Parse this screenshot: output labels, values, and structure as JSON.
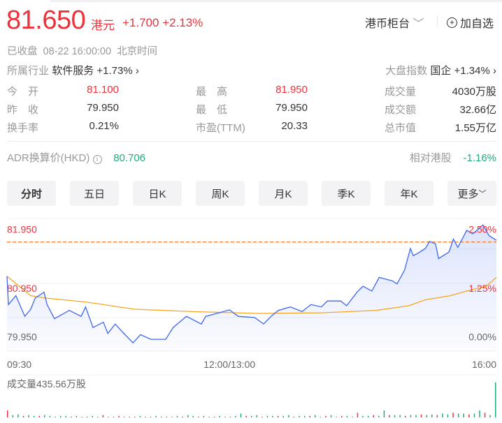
{
  "quote": {
    "price": "81.650",
    "currency": "港元",
    "change": "+1.700",
    "change_pct": "+2.13%"
  },
  "header": {
    "counter": "港币柜台",
    "add_watchlist": "加自选"
  },
  "status": {
    "state": "已收盘",
    "time": "08-22 16:00:00",
    "timezone": "北京时间"
  },
  "industry": {
    "label": "所属行业",
    "name": "软件服务",
    "change": "+1.73%"
  },
  "index": {
    "label": "大盘指数",
    "name": "国企",
    "change": "+1.34%"
  },
  "stats": [
    {
      "label": "今　开",
      "value": "81.100",
      "color": "red"
    },
    {
      "label": "最　高",
      "value": "81.950",
      "color": "red"
    },
    {
      "label": "成交量",
      "value": "4030万股",
      "color": ""
    },
    {
      "label": "昨　收",
      "value": "79.950",
      "color": ""
    },
    {
      "label": "最　低",
      "value": "79.950",
      "color": ""
    },
    {
      "label": "成交额",
      "value": "32.66亿",
      "color": ""
    },
    {
      "label": "换手率",
      "value": "0.21%",
      "color": ""
    },
    {
      "label": "市盈(TTM)",
      "value": "20.33",
      "color": ""
    },
    {
      "label": "总市值",
      "value": "1.55万亿",
      "color": ""
    }
  ],
  "adr": {
    "label": "ADR换算价(HKD)",
    "value": "80.706",
    "relative_label": "相对港股",
    "relative_value": "-1.16%"
  },
  "tabs": [
    "分时",
    "五日",
    "日K",
    "周K",
    "月K",
    "季K",
    "年K",
    "更多"
  ],
  "active_tab": "分时",
  "colors": {
    "up": "#f0303a",
    "down": "#1fad7e",
    "price_line": "#3d66f2",
    "avg_line": "#f5a623",
    "dash": "#f5873a"
  },
  "chart_data": {
    "type": "line",
    "title": "分时",
    "ylim": [
      79.8,
      82.05
    ],
    "xlim": [
      0,
      330
    ],
    "prev_close": 79.95,
    "last_price": 81.65,
    "y_labels_left": [
      "81.950",
      "80.950",
      "79.950"
    ],
    "y_label_values": [
      81.95,
      80.95,
      79.95
    ],
    "y_labels_right": [
      "2.50%",
      "1.25%",
      "0.00%"
    ],
    "x_labels": [
      "09:30",
      "12:00/13:00",
      "16:00"
    ],
    "x_label_values": [
      0,
      150,
      330
    ],
    "series": [
      {
        "name": "price",
        "points": [
          [
            0,
            81.07
          ],
          [
            1,
            80.59
          ],
          [
            6,
            80.74
          ],
          [
            12,
            80.39
          ],
          [
            16,
            80.51
          ],
          [
            19,
            80.7
          ],
          [
            25,
            80.8
          ],
          [
            27,
            80.59
          ],
          [
            32,
            80.35
          ],
          [
            42,
            80.49
          ],
          [
            50,
            80.39
          ],
          [
            53,
            80.55
          ],
          [
            58,
            80.2
          ],
          [
            65,
            80.29
          ],
          [
            68,
            80.1
          ],
          [
            73,
            80.26
          ],
          [
            78,
            80.12
          ],
          [
            85,
            79.94
          ],
          [
            90,
            80.08
          ],
          [
            97,
            80.0
          ],
          [
            107,
            80.0
          ],
          [
            112,
            80.2
          ],
          [
            121,
            80.39
          ],
          [
            131,
            80.26
          ],
          [
            134,
            80.39
          ],
          [
            143,
            80.45
          ],
          [
            150,
            80.5
          ],
          [
            156,
            80.39
          ],
          [
            167,
            80.37
          ],
          [
            173,
            80.26
          ],
          [
            178,
            80.39
          ],
          [
            183,
            80.49
          ],
          [
            191,
            80.55
          ],
          [
            199,
            80.47
          ],
          [
            205,
            80.59
          ],
          [
            212,
            80.55
          ],
          [
            216,
            80.65
          ],
          [
            225,
            80.65
          ],
          [
            229,
            80.57
          ],
          [
            236,
            80.8
          ],
          [
            240,
            80.9
          ],
          [
            246,
            80.82
          ],
          [
            251,
            81.05
          ],
          [
            260,
            80.99
          ],
          [
            263,
            80.94
          ],
          [
            268,
            81.17
          ],
          [
            272,
            81.54
          ],
          [
            274,
            81.42
          ],
          [
            277,
            81.46
          ],
          [
            282,
            81.54
          ],
          [
            285,
            81.66
          ],
          [
            289,
            81.62
          ],
          [
            291,
            81.37
          ],
          [
            298,
            81.48
          ],
          [
            301,
            81.7
          ],
          [
            304,
            81.56
          ],
          [
            310,
            81.85
          ],
          [
            314,
            81.79
          ],
          [
            321,
            81.94
          ],
          [
            325,
            81.76
          ],
          [
            330,
            81.68
          ]
        ]
      },
      {
        "name": "average",
        "points": [
          [
            0,
            81.07
          ],
          [
            16,
            80.74
          ],
          [
            26,
            80.7
          ],
          [
            54,
            80.63
          ],
          [
            86,
            80.51
          ],
          [
            125,
            80.47
          ],
          [
            169,
            80.44
          ],
          [
            212,
            80.45
          ],
          [
            249,
            80.49
          ],
          [
            271,
            80.57
          ],
          [
            282,
            80.67
          ],
          [
            299,
            80.74
          ],
          [
            310,
            80.82
          ],
          [
            323,
            80.9
          ],
          [
            330,
            81.05
          ]
        ]
      }
    ],
    "volume_label": "成交量435.56万股",
    "volume": [
      9,
      3,
      4,
      2,
      3,
      2,
      2,
      3,
      2,
      1,
      2,
      2,
      1,
      2,
      1,
      1,
      2,
      1,
      3,
      1,
      1,
      2,
      1,
      1,
      1,
      2,
      1,
      1,
      2,
      1,
      1,
      1,
      2,
      1,
      3,
      2,
      1,
      2,
      1,
      1,
      2,
      1,
      1,
      2,
      5,
      2,
      2,
      3,
      1,
      2,
      2,
      2,
      2,
      3,
      1,
      2,
      2,
      2,
      3,
      1,
      2,
      3,
      1,
      2,
      2,
      1,
      6,
      2,
      2,
      3,
      2,
      9,
      3,
      3,
      3,
      2,
      3,
      3,
      4,
      3,
      4,
      3,
      5,
      4,
      6,
      5,
      5,
      4,
      5,
      9,
      6,
      3,
      45
    ]
  }
}
